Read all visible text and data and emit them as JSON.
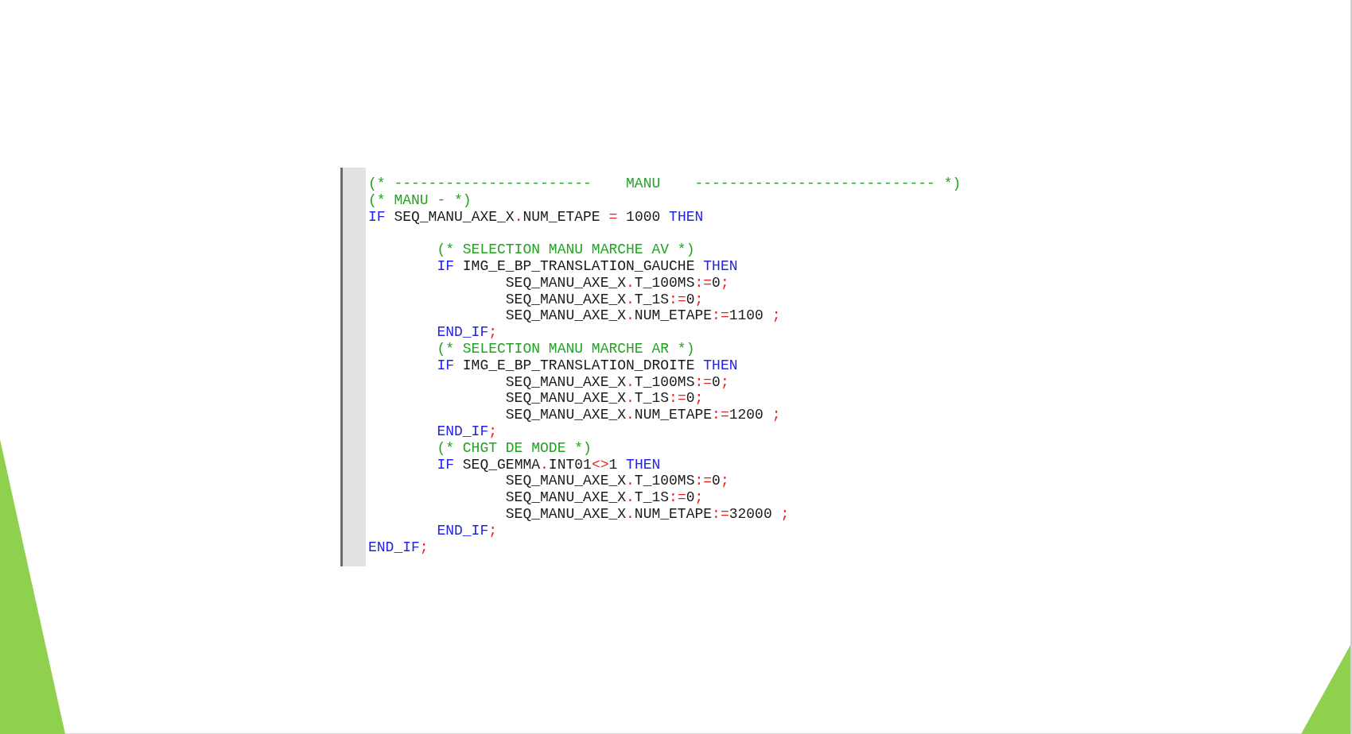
{
  "editor": {
    "lines": [
      {
        "tokens": [
          {
            "kind": "comment",
            "text": "(* -----------------------    MANU    ---------------------------- *)"
          }
        ]
      },
      {
        "tokens": [
          {
            "kind": "comment",
            "text": "(* MANU - *)"
          }
        ]
      },
      {
        "tokens": [
          {
            "kind": "keyword",
            "text": "IF"
          },
          {
            "kind": "plain",
            "text": " SEQ_MANU_AXE_X"
          },
          {
            "kind": "operator",
            "text": "."
          },
          {
            "kind": "plain",
            "text": "NUM_ETAPE "
          },
          {
            "kind": "operator",
            "text": "="
          },
          {
            "kind": "plain",
            "text": " 1000 "
          },
          {
            "kind": "keyword",
            "text": "THEN"
          }
        ],
        "children": [
          {
            "kind": "blank"
          },
          {
            "tokens": [
              {
                "kind": "comment",
                "text": "(* SELECTION MANU MARCHE AV *)"
              }
            ]
          },
          {
            "tokens": [
              {
                "kind": "keyword",
                "text": "IF"
              },
              {
                "kind": "plain",
                "text": " IMG_E_BP_TRANSLATION_GAUCHE "
              },
              {
                "kind": "keyword",
                "text": "THEN"
              }
            ],
            "children": [
              {
                "tokens": [
                  {
                    "kind": "plain",
                    "text": "SEQ_MANU_AXE_X"
                  },
                  {
                    "kind": "operator",
                    "text": "."
                  },
                  {
                    "kind": "plain",
                    "text": "T_100MS"
                  },
                  {
                    "kind": "operator",
                    "text": ":="
                  },
                  {
                    "kind": "plain",
                    "text": "0"
                  },
                  {
                    "kind": "operator",
                    "text": ";"
                  }
                ]
              },
              {
                "tokens": [
                  {
                    "kind": "plain",
                    "text": "SEQ_MANU_AXE_X"
                  },
                  {
                    "kind": "operator",
                    "text": "."
                  },
                  {
                    "kind": "plain",
                    "text": "T_1S"
                  },
                  {
                    "kind": "operator",
                    "text": ":="
                  },
                  {
                    "kind": "plain",
                    "text": "0"
                  },
                  {
                    "kind": "operator",
                    "text": ";"
                  }
                ]
              },
              {
                "tokens": [
                  {
                    "kind": "plain",
                    "text": "SEQ_MANU_AXE_X"
                  },
                  {
                    "kind": "operator",
                    "text": "."
                  },
                  {
                    "kind": "plain",
                    "text": "NUM_ETAPE"
                  },
                  {
                    "kind": "operator",
                    "text": ":="
                  },
                  {
                    "kind": "plain",
                    "text": "1100 "
                  },
                  {
                    "kind": "operator",
                    "text": ";"
                  }
                ]
              }
            ]
          },
          {
            "tokens": [
              {
                "kind": "keyword",
                "text": "END_IF"
              },
              {
                "kind": "operator",
                "text": ";"
              }
            ]
          },
          {
            "tokens": [
              {
                "kind": "comment",
                "text": "(* SELECTION MANU MARCHE AR *)"
              }
            ]
          },
          {
            "tokens": [
              {
                "kind": "keyword",
                "text": "IF"
              },
              {
                "kind": "plain",
                "text": " IMG_E_BP_TRANSLATION_DROITE "
              },
              {
                "kind": "keyword",
                "text": "THEN"
              }
            ],
            "children": [
              {
                "tokens": [
                  {
                    "kind": "plain",
                    "text": "SEQ_MANU_AXE_X"
                  },
                  {
                    "kind": "operator",
                    "text": "."
                  },
                  {
                    "kind": "plain",
                    "text": "T_100MS"
                  },
                  {
                    "kind": "operator",
                    "text": ":="
                  },
                  {
                    "kind": "plain",
                    "text": "0"
                  },
                  {
                    "kind": "operator",
                    "text": ";"
                  }
                ]
              },
              {
                "tokens": [
                  {
                    "kind": "plain",
                    "text": "SEQ_MANU_AXE_X"
                  },
                  {
                    "kind": "operator",
                    "text": "."
                  },
                  {
                    "kind": "plain",
                    "text": "T_1S"
                  },
                  {
                    "kind": "operator",
                    "text": ":="
                  },
                  {
                    "kind": "plain",
                    "text": "0"
                  },
                  {
                    "kind": "operator",
                    "text": ";"
                  }
                ]
              },
              {
                "tokens": [
                  {
                    "kind": "plain",
                    "text": "SEQ_MANU_AXE_X"
                  },
                  {
                    "kind": "operator",
                    "text": "."
                  },
                  {
                    "kind": "plain",
                    "text": "NUM_ETAPE"
                  },
                  {
                    "kind": "operator",
                    "text": ":="
                  },
                  {
                    "kind": "plain",
                    "text": "1200 "
                  },
                  {
                    "kind": "operator",
                    "text": ";"
                  }
                ]
              }
            ]
          },
          {
            "tokens": [
              {
                "kind": "keyword",
                "text": "END_IF"
              },
              {
                "kind": "operator",
                "text": ";"
              }
            ]
          },
          {
            "tokens": [
              {
                "kind": "comment",
                "text": "(* CHGT DE MODE *)"
              }
            ]
          },
          {
            "tokens": [
              {
                "kind": "keyword",
                "text": "IF"
              },
              {
                "kind": "plain",
                "text": " SEQ_GEMMA"
              },
              {
                "kind": "operator",
                "text": "."
              },
              {
                "kind": "plain",
                "text": "INT01"
              },
              {
                "kind": "operator",
                "text": "<>"
              },
              {
                "kind": "plain",
                "text": "1 "
              },
              {
                "kind": "keyword",
                "text": "THEN"
              }
            ],
            "children": [
              {
                "tokens": [
                  {
                    "kind": "plain",
                    "text": "SEQ_MANU_AXE_X"
                  },
                  {
                    "kind": "operator",
                    "text": "."
                  },
                  {
                    "kind": "plain",
                    "text": "T_100MS"
                  },
                  {
                    "kind": "operator",
                    "text": ":="
                  },
                  {
                    "kind": "plain",
                    "text": "0"
                  },
                  {
                    "kind": "operator",
                    "text": ";"
                  }
                ]
              },
              {
                "tokens": [
                  {
                    "kind": "plain",
                    "text": "SEQ_MANU_AXE_X"
                  },
                  {
                    "kind": "operator",
                    "text": "."
                  },
                  {
                    "kind": "plain",
                    "text": "T_1S"
                  },
                  {
                    "kind": "operator",
                    "text": ":="
                  },
                  {
                    "kind": "plain",
                    "text": "0"
                  },
                  {
                    "kind": "operator",
                    "text": ";"
                  }
                ]
              },
              {
                "tokens": [
                  {
                    "kind": "plain",
                    "text": "SEQ_MANU_AXE_X"
                  },
                  {
                    "kind": "operator",
                    "text": "."
                  },
                  {
                    "kind": "plain",
                    "text": "NUM_ETAPE"
                  },
                  {
                    "kind": "operator",
                    "text": ":="
                  },
                  {
                    "kind": "plain",
                    "text": "32000 "
                  },
                  {
                    "kind": "operator",
                    "text": ";"
                  }
                ]
              }
            ]
          },
          {
            "tokens": [
              {
                "kind": "keyword",
                "text": "END_IF"
              },
              {
                "kind": "operator",
                "text": ";"
              }
            ]
          }
        ]
      },
      {
        "tokens": [
          {
            "kind": "keyword",
            "text": "END_IF"
          },
          {
            "kind": "operator",
            "text": ";"
          }
        ]
      }
    ]
  }
}
